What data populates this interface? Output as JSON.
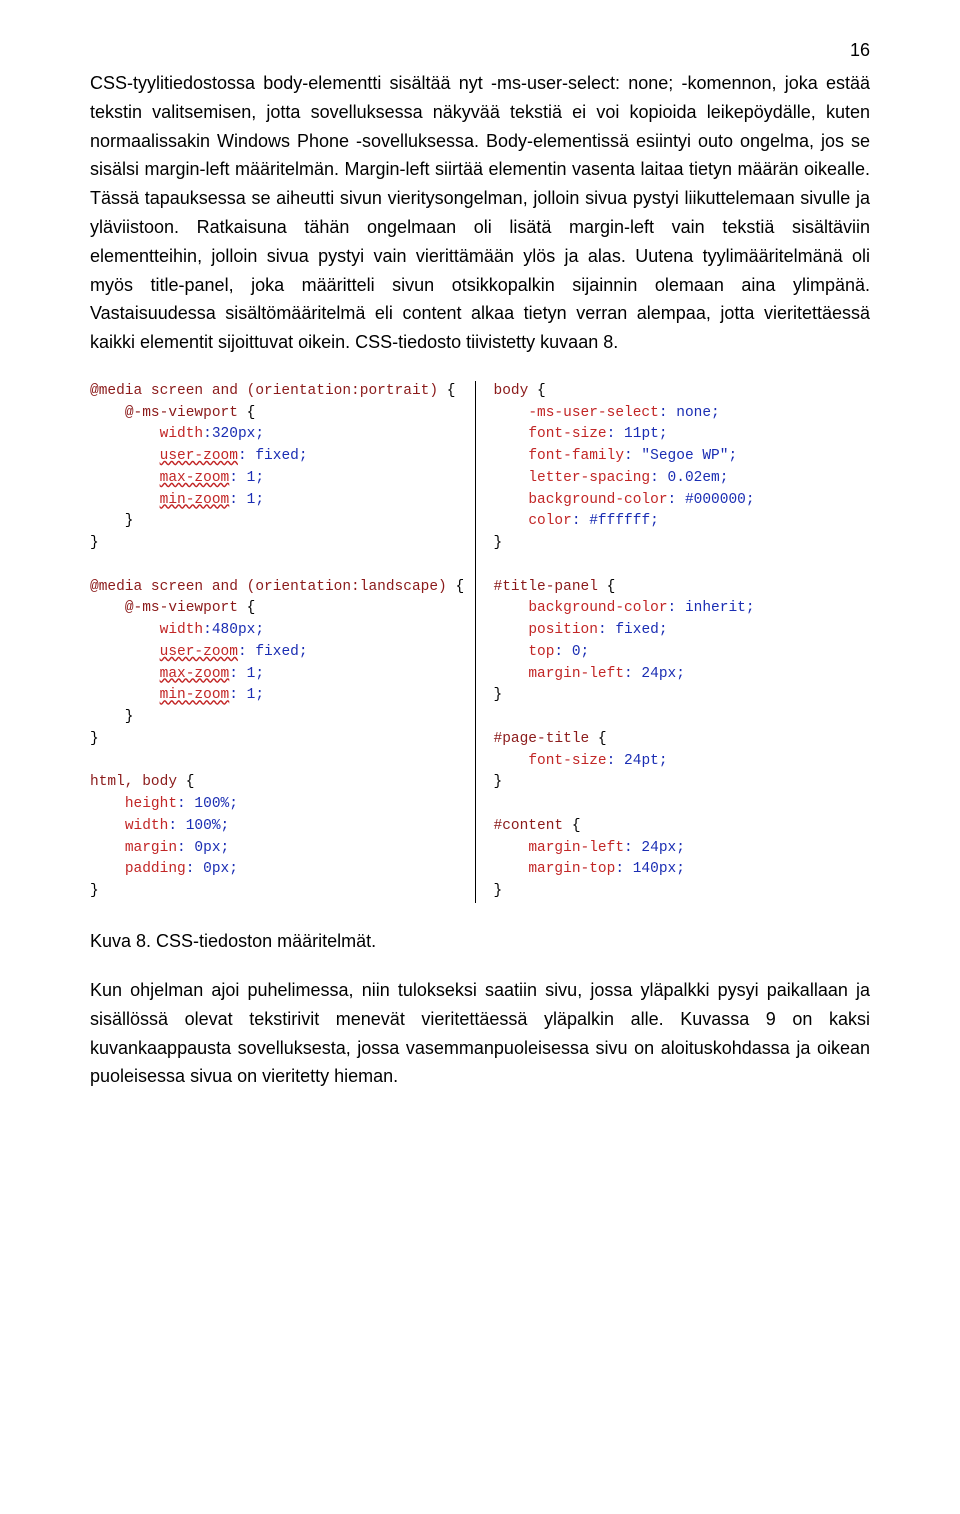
{
  "pageNumber": "16",
  "paragraph1": "CSS-tyylitiedostossa body-elementti sisältää nyt -ms-user-select: none; -komennon, joka estää tekstin valitsemisen, jotta sovelluksessa näkyvää tekstiä ei voi kopioida leikepöydälle, kuten normaalissakin Windows Phone -sovelluksessa. Body-elementissä esiintyi outo ongelma, jos se sisälsi margin-left määritelmän. Margin-left siirtää elementin vasenta laitaa tietyn määrän oikealle. Tässä tapauksessa se aiheutti sivun vieritysongelman, jolloin sivua pystyi liikuttelemaan sivulle ja yläviistoon. Ratkaisuna tähän ongelmaan oli lisätä margin-left vain tekstiä sisältäviin elementteihin, jolloin sivua pystyi vain vierittämään ylös ja alas. Uutena tyylimääritelmänä oli myös title-panel, joka määritteli sivun otsikkopalkin sijainnin olemaan aina ylimpänä. Vastaisuudessa sisältömääritelmä eli content alkaa tietyn verran alempaa, jotta vieritettäessä kaikki elementit sijoittuvat oikein. CSS-tiedosto tiivistetty kuvaan 8.",
  "caption": "Kuva 8. CSS-tiedoston määritelmät.",
  "paragraph2": "Kun ohjelman ajoi puhelimessa, niin tulokseksi saatiin sivu, jossa yläpalkki pysyi paikallaan ja sisällössä olevat tekstirivit menevät vieritettäessä yläpalkin alle. Kuvassa 9 on kaksi kuvankaappausta sovelluksesta, jossa vasemmanpuoleisessa sivu on aloituskohdassa ja oikean puoleisessa sivua on vieritetty hieman.",
  "code_left": [
    {
      "type": "line",
      "tokens": [
        {
          "c": "sel",
          "t": "@media screen and (orientation:portrait)"
        },
        {
          "c": "brace",
          "t": " {"
        }
      ]
    },
    {
      "type": "line",
      "tokens": [
        {
          "c": "brace",
          "t": "    "
        },
        {
          "c": "sel",
          "t": "@-ms-viewport"
        },
        {
          "c": "brace",
          "t": " {"
        }
      ]
    },
    {
      "type": "line",
      "tokens": [
        {
          "c": "brace",
          "t": "        "
        },
        {
          "c": "prop",
          "t": "width"
        },
        {
          "c": "val",
          "t": ":320px;"
        }
      ]
    },
    {
      "type": "line",
      "tokens": [
        {
          "c": "brace",
          "t": "        "
        },
        {
          "c": "prop wavy",
          "t": "user-zoom"
        },
        {
          "c": "val",
          "t": ": fixed;"
        }
      ]
    },
    {
      "type": "line",
      "tokens": [
        {
          "c": "brace",
          "t": "        "
        },
        {
          "c": "prop wavy",
          "t": "max-zoom"
        },
        {
          "c": "val",
          "t": ": 1;"
        }
      ]
    },
    {
      "type": "line",
      "tokens": [
        {
          "c": "brace",
          "t": "        "
        },
        {
          "c": "prop wavy",
          "t": "min-zoom"
        },
        {
          "c": "val",
          "t": ": 1;"
        }
      ]
    },
    {
      "type": "line",
      "tokens": [
        {
          "c": "brace",
          "t": "    }"
        }
      ]
    },
    {
      "type": "line",
      "tokens": [
        {
          "c": "brace",
          "t": "}"
        }
      ]
    },
    {
      "type": "line",
      "tokens": [
        {
          "c": "brace",
          "t": ""
        }
      ]
    },
    {
      "type": "line",
      "tokens": [
        {
          "c": "sel",
          "t": "@media screen and (orientation:landscape)"
        },
        {
          "c": "brace",
          "t": " {"
        }
      ]
    },
    {
      "type": "line",
      "tokens": [
        {
          "c": "brace",
          "t": "    "
        },
        {
          "c": "sel",
          "t": "@-ms-viewport"
        },
        {
          "c": "brace",
          "t": " {"
        }
      ]
    },
    {
      "type": "line",
      "tokens": [
        {
          "c": "brace",
          "t": "        "
        },
        {
          "c": "prop",
          "t": "width"
        },
        {
          "c": "val",
          "t": ":480px;"
        }
      ]
    },
    {
      "type": "line",
      "tokens": [
        {
          "c": "brace",
          "t": "        "
        },
        {
          "c": "prop wavy",
          "t": "user-zoom"
        },
        {
          "c": "val",
          "t": ": fixed;"
        }
      ]
    },
    {
      "type": "line",
      "tokens": [
        {
          "c": "brace",
          "t": "        "
        },
        {
          "c": "prop wavy",
          "t": "max-zoom"
        },
        {
          "c": "val",
          "t": ": 1;"
        }
      ]
    },
    {
      "type": "line",
      "tokens": [
        {
          "c": "brace",
          "t": "        "
        },
        {
          "c": "prop wavy",
          "t": "min-zoom"
        },
        {
          "c": "val",
          "t": ": 1;"
        }
      ]
    },
    {
      "type": "line",
      "tokens": [
        {
          "c": "brace",
          "t": "    }"
        }
      ]
    },
    {
      "type": "line",
      "tokens": [
        {
          "c": "brace",
          "t": "}"
        }
      ]
    },
    {
      "type": "line",
      "tokens": [
        {
          "c": "brace",
          "t": ""
        }
      ]
    },
    {
      "type": "line",
      "tokens": [
        {
          "c": "sel",
          "t": "html, body"
        },
        {
          "c": "brace",
          "t": " {"
        }
      ]
    },
    {
      "type": "line",
      "tokens": [
        {
          "c": "brace",
          "t": "    "
        },
        {
          "c": "prop",
          "t": "height"
        },
        {
          "c": "val",
          "t": ": 100%;"
        }
      ]
    },
    {
      "type": "line",
      "tokens": [
        {
          "c": "brace",
          "t": "    "
        },
        {
          "c": "prop",
          "t": "width"
        },
        {
          "c": "val",
          "t": ": 100%;"
        }
      ]
    },
    {
      "type": "line",
      "tokens": [
        {
          "c": "brace",
          "t": "    "
        },
        {
          "c": "prop",
          "t": "margin"
        },
        {
          "c": "val",
          "t": ": 0px;"
        }
      ]
    },
    {
      "type": "line",
      "tokens": [
        {
          "c": "brace",
          "t": "    "
        },
        {
          "c": "prop",
          "t": "padding"
        },
        {
          "c": "val",
          "t": ": 0px;"
        }
      ]
    },
    {
      "type": "line",
      "tokens": [
        {
          "c": "brace",
          "t": "}"
        }
      ]
    }
  ],
  "code_right": [
    {
      "type": "line",
      "tokens": [
        {
          "c": "sel",
          "t": "body"
        },
        {
          "c": "brace",
          "t": " {"
        }
      ]
    },
    {
      "type": "line",
      "tokens": [
        {
          "c": "brace",
          "t": "    "
        },
        {
          "c": "prop",
          "t": "-ms-user-select"
        },
        {
          "c": "val",
          "t": ": none;"
        }
      ]
    },
    {
      "type": "line",
      "tokens": [
        {
          "c": "brace",
          "t": "    "
        },
        {
          "c": "prop",
          "t": "font-size"
        },
        {
          "c": "val",
          "t": ": 11pt;"
        }
      ]
    },
    {
      "type": "line",
      "tokens": [
        {
          "c": "brace",
          "t": "    "
        },
        {
          "c": "prop",
          "t": "font-family"
        },
        {
          "c": "val",
          "t": ": \"Segoe WP\";"
        }
      ]
    },
    {
      "type": "line",
      "tokens": [
        {
          "c": "brace",
          "t": "    "
        },
        {
          "c": "prop",
          "t": "letter-spacing"
        },
        {
          "c": "val",
          "t": ": 0.02em;"
        }
      ]
    },
    {
      "type": "line",
      "tokens": [
        {
          "c": "brace",
          "t": "    "
        },
        {
          "c": "prop",
          "t": "background-color"
        },
        {
          "c": "val",
          "t": ": #000000;"
        }
      ]
    },
    {
      "type": "line",
      "tokens": [
        {
          "c": "brace",
          "t": "    "
        },
        {
          "c": "prop",
          "t": "color"
        },
        {
          "c": "val",
          "t": ": #ffffff;"
        }
      ]
    },
    {
      "type": "line",
      "tokens": [
        {
          "c": "brace",
          "t": "}"
        }
      ]
    },
    {
      "type": "line",
      "tokens": [
        {
          "c": "brace",
          "t": ""
        }
      ]
    },
    {
      "type": "line",
      "tokens": [
        {
          "c": "sel",
          "t": "#title-panel"
        },
        {
          "c": "brace",
          "t": " {"
        }
      ]
    },
    {
      "type": "line",
      "tokens": [
        {
          "c": "brace",
          "t": "    "
        },
        {
          "c": "prop",
          "t": "background-color"
        },
        {
          "c": "val",
          "t": ": inherit;"
        }
      ]
    },
    {
      "type": "line",
      "tokens": [
        {
          "c": "brace",
          "t": "    "
        },
        {
          "c": "prop",
          "t": "position"
        },
        {
          "c": "val",
          "t": ": fixed;"
        }
      ]
    },
    {
      "type": "line",
      "tokens": [
        {
          "c": "brace",
          "t": "    "
        },
        {
          "c": "prop",
          "t": "top"
        },
        {
          "c": "val",
          "t": ": 0;"
        }
      ]
    },
    {
      "type": "line",
      "tokens": [
        {
          "c": "brace",
          "t": "    "
        },
        {
          "c": "prop",
          "t": "margin-left"
        },
        {
          "c": "val",
          "t": ": 24px;"
        }
      ]
    },
    {
      "type": "line",
      "tokens": [
        {
          "c": "brace",
          "t": "}"
        }
      ]
    },
    {
      "type": "line",
      "tokens": [
        {
          "c": "brace",
          "t": ""
        }
      ]
    },
    {
      "type": "line",
      "tokens": [
        {
          "c": "sel",
          "t": "#page-title"
        },
        {
          "c": "brace",
          "t": " {"
        }
      ]
    },
    {
      "type": "line",
      "tokens": [
        {
          "c": "brace",
          "t": "    "
        },
        {
          "c": "prop",
          "t": "font-size"
        },
        {
          "c": "val",
          "t": ": 24pt;"
        }
      ]
    },
    {
      "type": "line",
      "tokens": [
        {
          "c": "brace",
          "t": "}"
        }
      ]
    },
    {
      "type": "line",
      "tokens": [
        {
          "c": "brace",
          "t": ""
        }
      ]
    },
    {
      "type": "line",
      "tokens": [
        {
          "c": "sel",
          "t": "#content"
        },
        {
          "c": "brace",
          "t": " {"
        }
      ]
    },
    {
      "type": "line",
      "tokens": [
        {
          "c": "brace",
          "t": "    "
        },
        {
          "c": "prop",
          "t": "margin-left"
        },
        {
          "c": "val",
          "t": ": 24px;"
        }
      ]
    },
    {
      "type": "line",
      "tokens": [
        {
          "c": "brace",
          "t": "    "
        },
        {
          "c": "prop",
          "t": "margin-top"
        },
        {
          "c": "val",
          "t": ": 140px;"
        }
      ]
    },
    {
      "type": "line",
      "tokens": [
        {
          "c": "brace",
          "t": "}"
        }
      ]
    }
  ]
}
